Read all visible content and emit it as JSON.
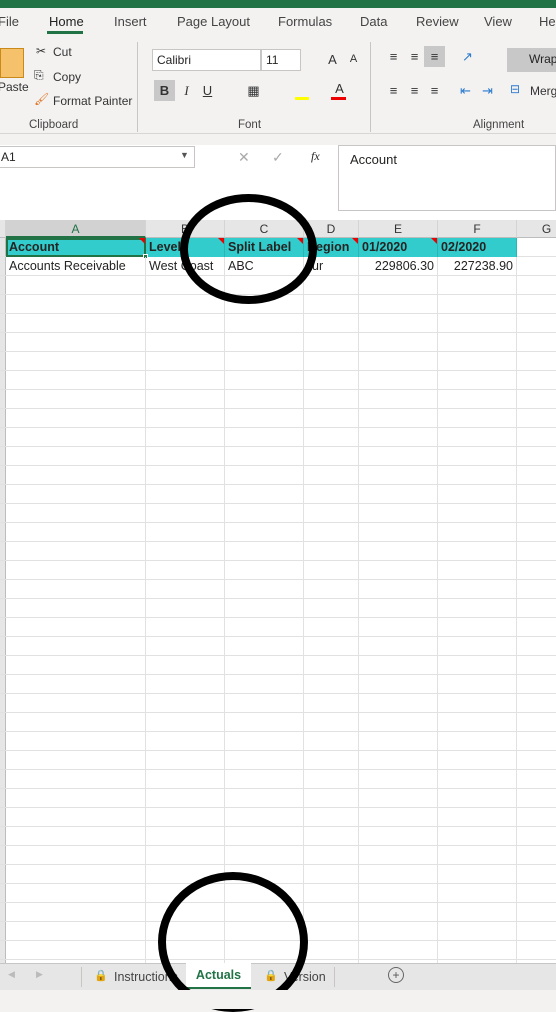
{
  "menu": {
    "tabs": [
      "File",
      "Home",
      "Insert",
      "Page Layout",
      "Formulas",
      "Data",
      "Review",
      "View",
      "He"
    ],
    "active": "Home"
  },
  "clipboard": {
    "paste": "Paste",
    "cut": "Cut",
    "copy": "Copy",
    "format_painter": "Format Painter",
    "label": "Clipboard"
  },
  "font": {
    "name": "Calibri",
    "size": "11",
    "label": "Font",
    "bold": "B",
    "italic": "I",
    "underline": "U",
    "grow": "A",
    "shrink": "A",
    "color_letter": "A"
  },
  "alignment": {
    "wrap": "Wrap",
    "merge": "Merg",
    "label": "Alignment"
  },
  "formula_bar": {
    "name_box": "A1",
    "fx": "fx",
    "cancel": "✕",
    "enter": "✓",
    "value": "Account"
  },
  "columns": [
    "A",
    "B",
    "C",
    "D",
    "E",
    "F",
    "G"
  ],
  "header_row": [
    "Account",
    "Level",
    "Split Label",
    "Region",
    "01/2020",
    "02/2020"
  ],
  "data_rows": [
    [
      "Accounts Receivable",
      "West Coast",
      "ABC",
      "ur",
      "229806.30",
      "227238.90"
    ]
  ],
  "sheets": {
    "tabs": [
      "Instructions",
      "Actuals",
      "Version"
    ],
    "active": "Actuals",
    "add": "+"
  },
  "colors": {
    "accent": "#217346",
    "header_fill": "#33cccc",
    "comment": "#e00000"
  }
}
